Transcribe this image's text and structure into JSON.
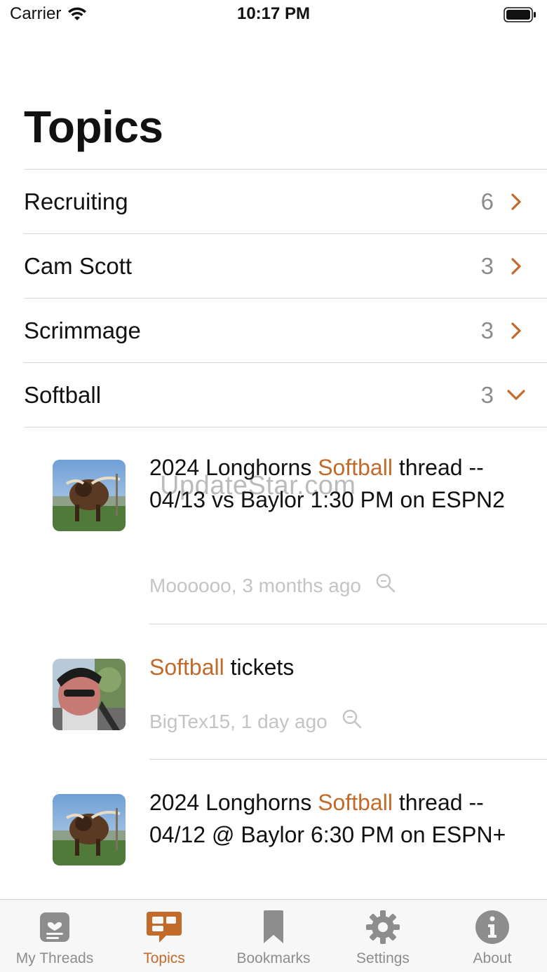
{
  "status_bar": {
    "carrier": "Carrier",
    "time": "10:17 PM"
  },
  "page": {
    "title": "Topics"
  },
  "colors": {
    "accent": "#c26a2a",
    "muted": "#8a8a8a",
    "meta": "#c4c4c4",
    "divider": "#d8d8d8"
  },
  "topics": [
    {
      "label": "Recruiting",
      "count": "6",
      "expanded": false
    },
    {
      "label": "Cam Scott",
      "count": "3",
      "expanded": false
    },
    {
      "label": "Scrimmage",
      "count": "3",
      "expanded": false
    },
    {
      "label": "Softball",
      "count": "3",
      "expanded": true
    }
  ],
  "threads": [
    {
      "title_pre": "2024 Longhorns ",
      "title_hl": "Softball",
      "title_post": " thread -- 04/13 vs Baylor 1:30 PM on ESPN2",
      "meta": "Moooooo, 3 months ago",
      "avatar": "longhorn-avatar"
    },
    {
      "title_pre": "",
      "title_hl": "Softball",
      "title_post": " tickets",
      "meta": "BigTex15, 1 day ago",
      "avatar": "person-avatar"
    },
    {
      "title_pre": "2024 Longhorns ",
      "title_hl": "Softball",
      "title_post": " thread -- 04/12 @ Baylor 6:30 PM on ESPN+",
      "meta": "",
      "avatar": "longhorn-avatar"
    }
  ],
  "watermark": "UpdateStar.com",
  "tab_bar": {
    "tabs": [
      {
        "label": "My Threads",
        "icon": "my-threads-icon",
        "active": false
      },
      {
        "label": "Topics",
        "icon": "topics-icon",
        "active": true
      },
      {
        "label": "Bookmarks",
        "icon": "bookmark-icon",
        "active": false
      },
      {
        "label": "Settings",
        "icon": "gear-icon",
        "active": false
      },
      {
        "label": "About",
        "icon": "info-icon",
        "active": false
      }
    ]
  }
}
